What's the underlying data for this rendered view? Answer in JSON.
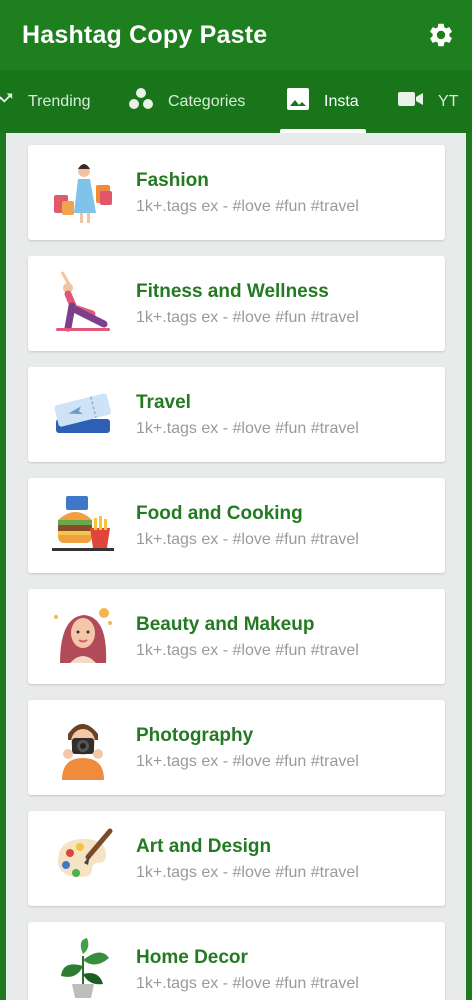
{
  "app": {
    "title": "Hashtag Copy Paste",
    "settings_icon": "gear-icon"
  },
  "tabs": [
    {
      "label": "Trending",
      "icon": "trending-up-icon",
      "active": false
    },
    {
      "label": "Categories",
      "icon": "categories-dots-icon",
      "active": false
    },
    {
      "label": "Insta",
      "icon": "image-icon",
      "active": true
    },
    {
      "label": "YT",
      "icon": "video-camera-icon",
      "active": false
    }
  ],
  "categories": [
    {
      "title": "Fashion",
      "subtitle": "1k+.tags ex - #love #fun #travel",
      "icon": "fashion-shopping-woman-icon"
    },
    {
      "title": "Fitness and Wellness",
      "subtitle": "1k+.tags ex - #love #fun #travel",
      "icon": "yoga-pose-icon"
    },
    {
      "title": "Travel",
      "subtitle": "1k+.tags ex - #love #fun #travel",
      "icon": "plane-ticket-icon"
    },
    {
      "title": "Food and Cooking",
      "subtitle": "1k+.tags ex - #love #fun #travel",
      "icon": "fast-food-icon"
    },
    {
      "title": "Beauty and Makeup",
      "subtitle": "1k+.tags ex - #love #fun #travel",
      "icon": "beauty-woman-icon"
    },
    {
      "title": "Photography",
      "subtitle": "1k+.tags ex - #love #fun #travel",
      "icon": "photographer-icon"
    },
    {
      "title": "Art and Design",
      "subtitle": "1k+.tags ex - #love #fun #travel",
      "icon": "paint-palette-icon"
    },
    {
      "title": "Home Decor",
      "subtitle": "1k+.tags ex - #love #fun #travel",
      "icon": "house-plant-icon"
    }
  ],
  "colors": {
    "primary": "#1e7f1e",
    "tab_bar": "#197519",
    "title_green": "#237a23",
    "subtitle_gray": "#9a9a9a",
    "list_background": "#e9eaea"
  }
}
